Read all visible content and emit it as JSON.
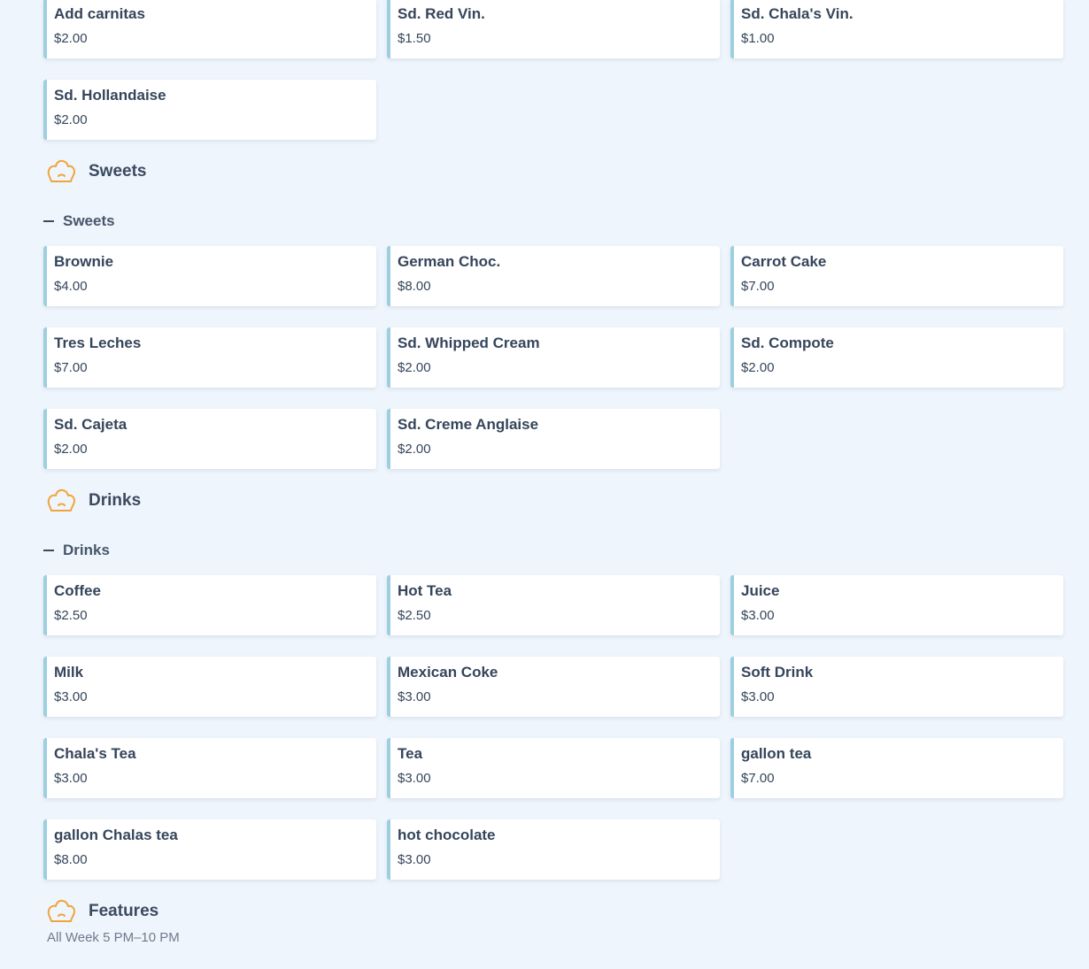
{
  "extras": {
    "items": [
      {
        "name": "Add carnitas",
        "price": "$2.00"
      },
      {
        "name": "Sd. Red Vin.",
        "price": "$1.50"
      },
      {
        "name": "Sd. Chala's Vin.",
        "price": "$1.00"
      },
      {
        "name": "Sd. Hollandaise",
        "price": "$2.00"
      }
    ]
  },
  "sweets": {
    "title": "Sweets",
    "subcategory": "Sweets",
    "items": [
      {
        "name": "Brownie",
        "price": "$4.00"
      },
      {
        "name": "German Choc.",
        "price": "$8.00"
      },
      {
        "name": "Carrot Cake",
        "price": "$7.00"
      },
      {
        "name": "Tres Leches",
        "price": "$7.00"
      },
      {
        "name": "Sd. Whipped Cream",
        "price": "$2.00"
      },
      {
        "name": "Sd. Compote",
        "price": "$2.00"
      },
      {
        "name": "Sd. Cajeta",
        "price": "$2.00"
      },
      {
        "name": "Sd. Creme Anglaise",
        "price": "$2.00"
      }
    ]
  },
  "drinks": {
    "title": "Drinks",
    "subcategory": "Drinks",
    "items": [
      {
        "name": "Coffee",
        "price": "$2.50"
      },
      {
        "name": "Hot Tea",
        "price": "$2.50"
      },
      {
        "name": "Juice",
        "price": "$3.00"
      },
      {
        "name": "Milk",
        "price": "$3.00"
      },
      {
        "name": "Mexican Coke",
        "price": "$3.00"
      },
      {
        "name": "Soft Drink",
        "price": "$3.00"
      },
      {
        "name": "Chala's Tea",
        "price": "$3.00"
      },
      {
        "name": "Tea",
        "price": "$3.00"
      },
      {
        "name": "gallon tea",
        "price": "$7.00"
      },
      {
        "name": "gallon Chalas tea",
        "price": "$8.00"
      },
      {
        "name": "hot chocolate",
        "price": "$3.00"
      }
    ]
  },
  "features": {
    "title": "Features",
    "hours": "All Week 5 PM–10 PM"
  },
  "icons": {
    "category": "chef-hat-icon",
    "collapse": "minus-icon"
  },
  "colors": {
    "background": "#eff5fc",
    "card_accent": "#9ccfdf",
    "icon": "#f0a43a",
    "text": "#35455b"
  }
}
